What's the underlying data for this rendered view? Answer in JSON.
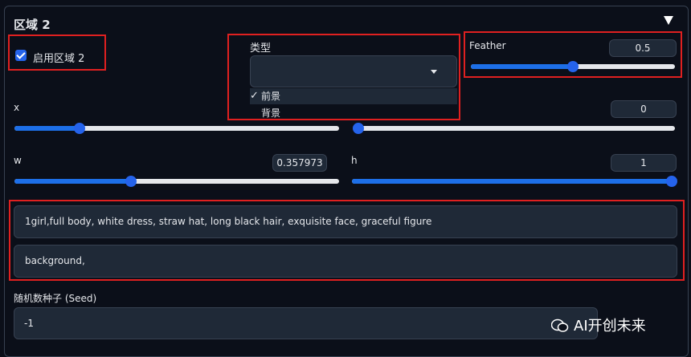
{
  "section": {
    "title": "区域 2"
  },
  "enable": {
    "label": "启用区域 2",
    "checked": true
  },
  "type_select": {
    "label": "类型",
    "value": "",
    "options": [
      "前景",
      "背景"
    ],
    "selected": "前景",
    "check_mark": "✓"
  },
  "feather": {
    "label": "Feather",
    "value": "0.5",
    "fraction": 0.5
  },
  "x": {
    "label": "x",
    "fraction": 0.2
  },
  "y": {
    "value": "0",
    "fraction": 0.0
  },
  "w": {
    "label": "w",
    "value": "0.357973",
    "fraction": 0.357973
  },
  "h": {
    "label": "h",
    "value": "1",
    "fraction": 1.0
  },
  "prompts": {
    "positive": "1girl,full body, white dress, straw hat, long black hair, exquisite face, graceful figure",
    "negative": "background,"
  },
  "seed": {
    "label": "随机数种子 (Seed)",
    "value": "-1"
  },
  "watermark": {
    "text": "AI开创未来"
  },
  "colors": {
    "accent": "#2563eb",
    "highlight": "#e02020",
    "background": "#0b0f19",
    "field": "#1f2937"
  }
}
